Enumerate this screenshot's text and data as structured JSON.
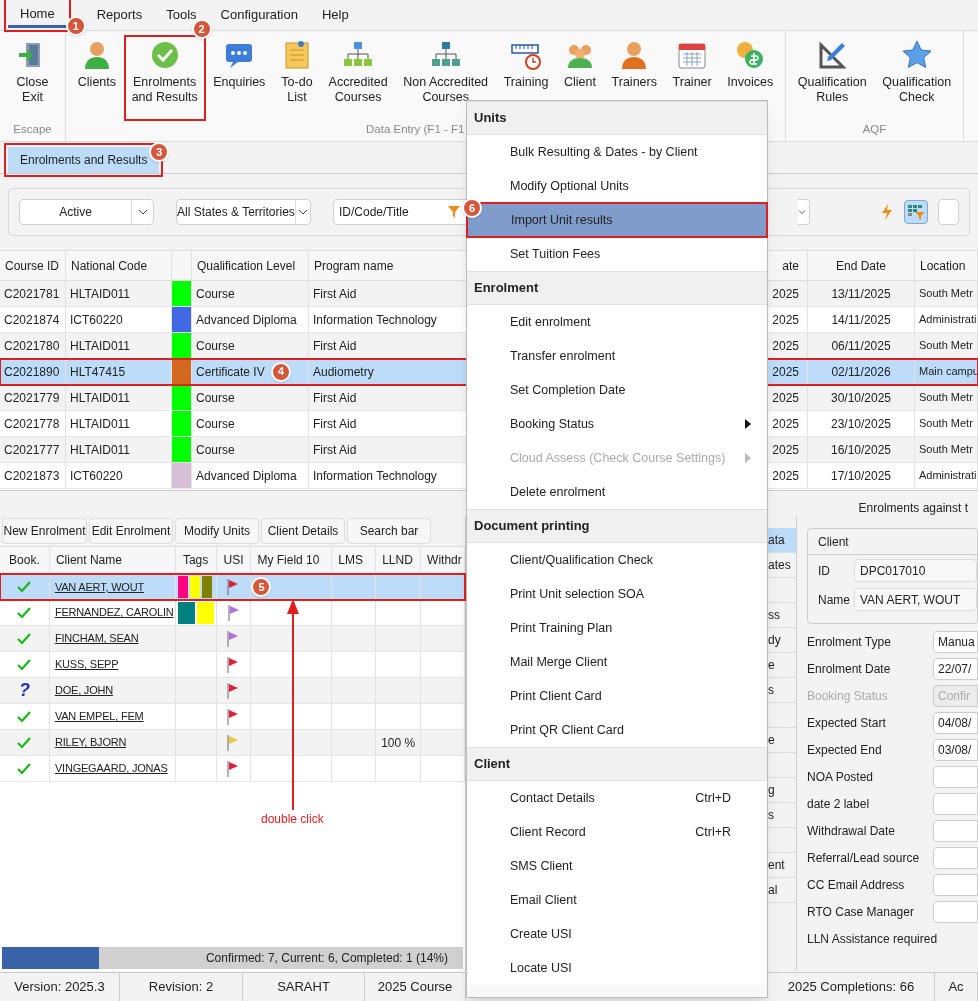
{
  "menu_bar": [
    {
      "label": "Home",
      "selected": true,
      "callout": "1"
    },
    {
      "label": "Reports",
      "selected": false
    },
    {
      "label": "Tools",
      "selected": false
    },
    {
      "label": "Configuration",
      "selected": false
    },
    {
      "label": "Help",
      "selected": false
    }
  ],
  "ribbon": {
    "groups": [
      {
        "label": "Escape",
        "buttons": [
          {
            "lines": [
              "Close",
              "Exit"
            ]
          }
        ]
      },
      {
        "label": "Data Entry (F1 - F1",
        "buttons": [
          {
            "lines": [
              "Clients"
            ]
          },
          {
            "lines": [
              "Enrolments",
              "and Results"
            ],
            "callout": "2"
          },
          {
            "lines": [
              "Enquiries"
            ]
          },
          {
            "lines": [
              "To-do",
              "List"
            ]
          },
          {
            "lines": [
              "Accredited",
              "Courses"
            ]
          },
          {
            "lines": [
              "Non Accredited",
              "Courses"
            ]
          },
          {
            "lines": [
              "Training"
            ]
          },
          {
            "lines": [
              "Client"
            ]
          },
          {
            "lines": [
              "Trainers"
            ]
          },
          {
            "lines": [
              "Trainer"
            ]
          },
          {
            "lines": [
              "Invoices"
            ]
          }
        ]
      },
      {
        "label": "AQF",
        "buttons": [
          {
            "lines": [
              "Qualification",
              "Rules"
            ]
          },
          {
            "lines": [
              "Qualification",
              "Check"
            ]
          }
        ]
      }
    ]
  },
  "doc_tabs": [
    {
      "label": "Enrolments and Results",
      "selected": true,
      "callout": "3"
    }
  ],
  "filters": {
    "status": "Active",
    "states": "All States & Territories",
    "search_by": "ID/Code/Title"
  },
  "courses": {
    "columns": [
      "Course ID",
      "National Code",
      "Qualification Level",
      "Program name",
      "ate",
      "End Date",
      "Location"
    ],
    "rows": [
      {
        "course_id": "C2021781",
        "national_code": "HLTAID011",
        "color": "#00ff00",
        "qualification_level": "Course",
        "program_name": "First Aid",
        "column_5": "2025",
        "end_date": "13/11/2025",
        "location": "South Metr",
        "selected": false
      },
      {
        "course_id": "C2021874",
        "national_code": "ICT60220",
        "color": "#4169e1",
        "qualification_level": "Advanced Diploma",
        "program_name": "Information Technology",
        "column_5": "2025",
        "end_date": "14/11/2025",
        "location": "Administrati",
        "selected": false
      },
      {
        "course_id": "C2021780",
        "national_code": "HLTAID011",
        "color": "#00ff00",
        "qualification_level": "Course",
        "program_name": "First Aid",
        "column_5": "2025",
        "end_date": "06/11/2025",
        "location": "South Metr",
        "selected": false
      },
      {
        "course_id": "C2021890",
        "national_code": "HLT47415",
        "color": "#d2691e",
        "qualification_level": "Certificate IV",
        "program_name": "Audiometry",
        "column_5": "2025",
        "end_date": "02/11/2026",
        "location": "Main campu",
        "selected": true,
        "callout": "4"
      },
      {
        "course_id": "C2021779",
        "national_code": "HLTAID011",
        "color": "#00ff00",
        "qualification_level": "Course",
        "program_name": "First Aid",
        "column_5": "2025",
        "end_date": "30/10/2025",
        "location": "South Metr",
        "selected": false
      },
      {
        "course_id": "C2021778",
        "national_code": "HLTAID011",
        "color": "#00ff00",
        "qualification_level": "Course",
        "program_name": "First Aid",
        "column_5": "2025",
        "end_date": "23/10/2025",
        "location": "South Metr",
        "selected": false
      },
      {
        "course_id": "C2021777",
        "national_code": "HLTAID011",
        "color": "#00ff00",
        "qualification_level": "Course",
        "program_name": "First Aid",
        "column_5": "2025",
        "end_date": "16/10/2025",
        "location": "South Metr",
        "selected": false
      },
      {
        "course_id": "C2021873",
        "national_code": "ICT60220",
        "color": "#d8bfd8",
        "qualification_level": "Advanced Diploma",
        "program_name": "Information Technology",
        "column_5": "2025",
        "end_date": "17/10/2025",
        "location": "Administrati",
        "selected": false
      }
    ]
  },
  "panel_title": "Enrolments against t",
  "enrolment_buttons": [
    "New Enrolment",
    "Edit Enrolment",
    "Modify Units",
    "Client Details",
    "Search bar"
  ],
  "clients": {
    "columns": [
      "Book.",
      "Client Name",
      "Tags",
      "USI",
      "My Field 10",
      "LMS",
      "LLND",
      "Withdr"
    ],
    "rows": [
      {
        "book": {
          "kind": "check"
        },
        "client_name": "VAN AERT, WOUT",
        "tags": [
          {
            "color": "#ff0080"
          },
          {
            "color": "#ffff00"
          },
          {
            "color": "#808000"
          }
        ],
        "usi_flag": {
          "color": "#e0203a"
        },
        "selected": true,
        "callout": "5"
      },
      {
        "book": {
          "kind": "check"
        },
        "client_name": "FERNANDEZ, CAROLIN",
        "tags": [
          {
            "color": "#008080"
          },
          {
            "color": "#ffff00"
          }
        ],
        "usi_flag": {
          "color": "#b070e0"
        },
        "selected": false
      },
      {
        "book": {
          "kind": "check"
        },
        "client_name": "FINCHAM, SEAN",
        "usi_flag": {
          "color": "#b070e0"
        },
        "selected": false
      },
      {
        "book": {
          "kind": "check"
        },
        "client_name": "KUSS, SEPP",
        "usi_flag": {
          "color": "#e0203a"
        },
        "selected": false
      },
      {
        "book": {
          "kind": "mark",
          "text": "?"
        },
        "client_name": "DOE, JOHN",
        "usi_flag": {
          "color": "#e0203a"
        },
        "selected": false
      },
      {
        "book": {
          "kind": "check"
        },
        "client_name": "VAN EMPEL, FEM",
        "usi_flag": {
          "color": "#e0203a"
        },
        "selected": false
      },
      {
        "book": {
          "kind": "check"
        },
        "client_name": "RILEY, BJORN",
        "usi_flag": {
          "color": "#e8c840"
        },
        "llnd": "100 %",
        "selected": false
      },
      {
        "book": {
          "kind": "check"
        },
        "client_name": "VINGEGAARD, JONAS",
        "usi_flag": {
          "color": "#e0203a"
        },
        "selected": false
      }
    ]
  },
  "annotation": {
    "text": "double click"
  },
  "progress": {
    "level": 0.21,
    "text": "Confirmed: 7, Current: 6, Completed: 1 (14%)"
  },
  "side_tabs": [
    {
      "label": "ata",
      "selected": true
    },
    {
      "label": "ates",
      "selected": false
    },
    {
      "selected": false
    },
    {
      "label": "ss",
      "selected": false
    },
    {
      "label": "dy",
      "selected": false
    },
    {
      "label": "e",
      "selected": false
    },
    {
      "label": "s",
      "selected": false
    },
    {
      "selected": false
    },
    {
      "label": "e",
      "selected": false
    },
    {
      "selected": false
    },
    {
      "label": "g",
      "selected": false
    },
    {
      "label": "s",
      "selected": false
    },
    {
      "selected": false
    },
    {
      "label": "ent",
      "selected": false
    },
    {
      "label": "al",
      "selected": false
    }
  ],
  "client_group": {
    "title": "Client",
    "id_label": "ID",
    "id": "DPC017010",
    "name_label": "Name",
    "name": "VAN AERT, WOUT"
  },
  "form": [
    {
      "kind": "field",
      "label": "Enrolment Type",
      "value": "Manua",
      "disabled": false
    },
    {
      "kind": "field",
      "label": "Enrolment Date",
      "value": "22/07/",
      "disabled": false
    },
    {
      "kind": "field",
      "label": "Booking Status",
      "value": "Confir",
      "disabled": true
    },
    {
      "kind": "field",
      "label": "Expected Start",
      "value": "04/08/",
      "disabled": false
    },
    {
      "kind": "field",
      "label": "Expected End",
      "value": "03/08/",
      "disabled": false
    },
    {
      "kind": "field",
      "label": "NOA Posted",
      "disabled": false
    },
    {
      "kind": "field",
      "label": "date 2 label",
      "disabled": false
    },
    {
      "kind": "field",
      "label": "Withdrawal Date",
      "disabled": false
    },
    {
      "kind": "field",
      "label": "Referral/Lead source",
      "disabled": false
    },
    {
      "kind": "field",
      "label": "CC Email Address",
      "disabled": false
    },
    {
      "kind": "field",
      "label": "RTO Case Manager",
      "disabled": false
    },
    {
      "kind": "text",
      "label": "LLN Assistance required"
    }
  ],
  "status_bar": [
    "Version: 2025.3",
    "Revision: 2",
    "SARAHT",
    "2025 Course",
    "2025 Completions: 66",
    "Ac"
  ],
  "context_menu": [
    {
      "title": "Units",
      "items": [
        {
          "label": "Bulk Resulting & Dates - by Client",
          "selected": false
        },
        {
          "label": "Modify Optional Units",
          "selected": false
        },
        {
          "label": "Import Unit results",
          "selected": true,
          "callout": "6"
        },
        {
          "label": "Set Tuition Fees",
          "selected": false
        }
      ]
    },
    {
      "title": "Enrolment",
      "items": [
        {
          "label": "Edit enrolment",
          "selected": false
        },
        {
          "label": "Transfer enrolment",
          "selected": false
        },
        {
          "label": "Set Completion Date",
          "selected": false
        },
        {
          "label": "Booking Status",
          "selected": false,
          "submenu": true
        },
        {
          "label": "Cloud Assess (Check Course Settings)",
          "selected": false,
          "submenu": true,
          "disabled": true
        },
        {
          "label": "Delete enrolment",
          "selected": false
        }
      ]
    },
    {
      "title": "Document printing",
      "items": [
        {
          "label": "Client/Qualification Check",
          "selected": false
        },
        {
          "label": "Print Unit selection SOA",
          "selected": false
        },
        {
          "label": "Print Training Plan",
          "selected": false
        },
        {
          "label": "Mail Merge Client",
          "selected": false
        },
        {
          "label": "Print Client Card",
          "selected": false
        },
        {
          "label": "Print QR Client Card",
          "selected": false
        }
      ]
    },
    {
      "title": "Client",
      "items": [
        {
          "label": "Contact Details",
          "shortcut": "Ctrl+D",
          "selected": false
        },
        {
          "label": "Client Record",
          "shortcut": "Ctrl+R",
          "selected": false
        },
        {
          "label": "SMS Client",
          "selected": false
        },
        {
          "label": "Email Client",
          "selected": false
        },
        {
          "label": "Create USI",
          "selected": false
        },
        {
          "label": "Locate USI",
          "selected": false
        }
      ]
    }
  ]
}
